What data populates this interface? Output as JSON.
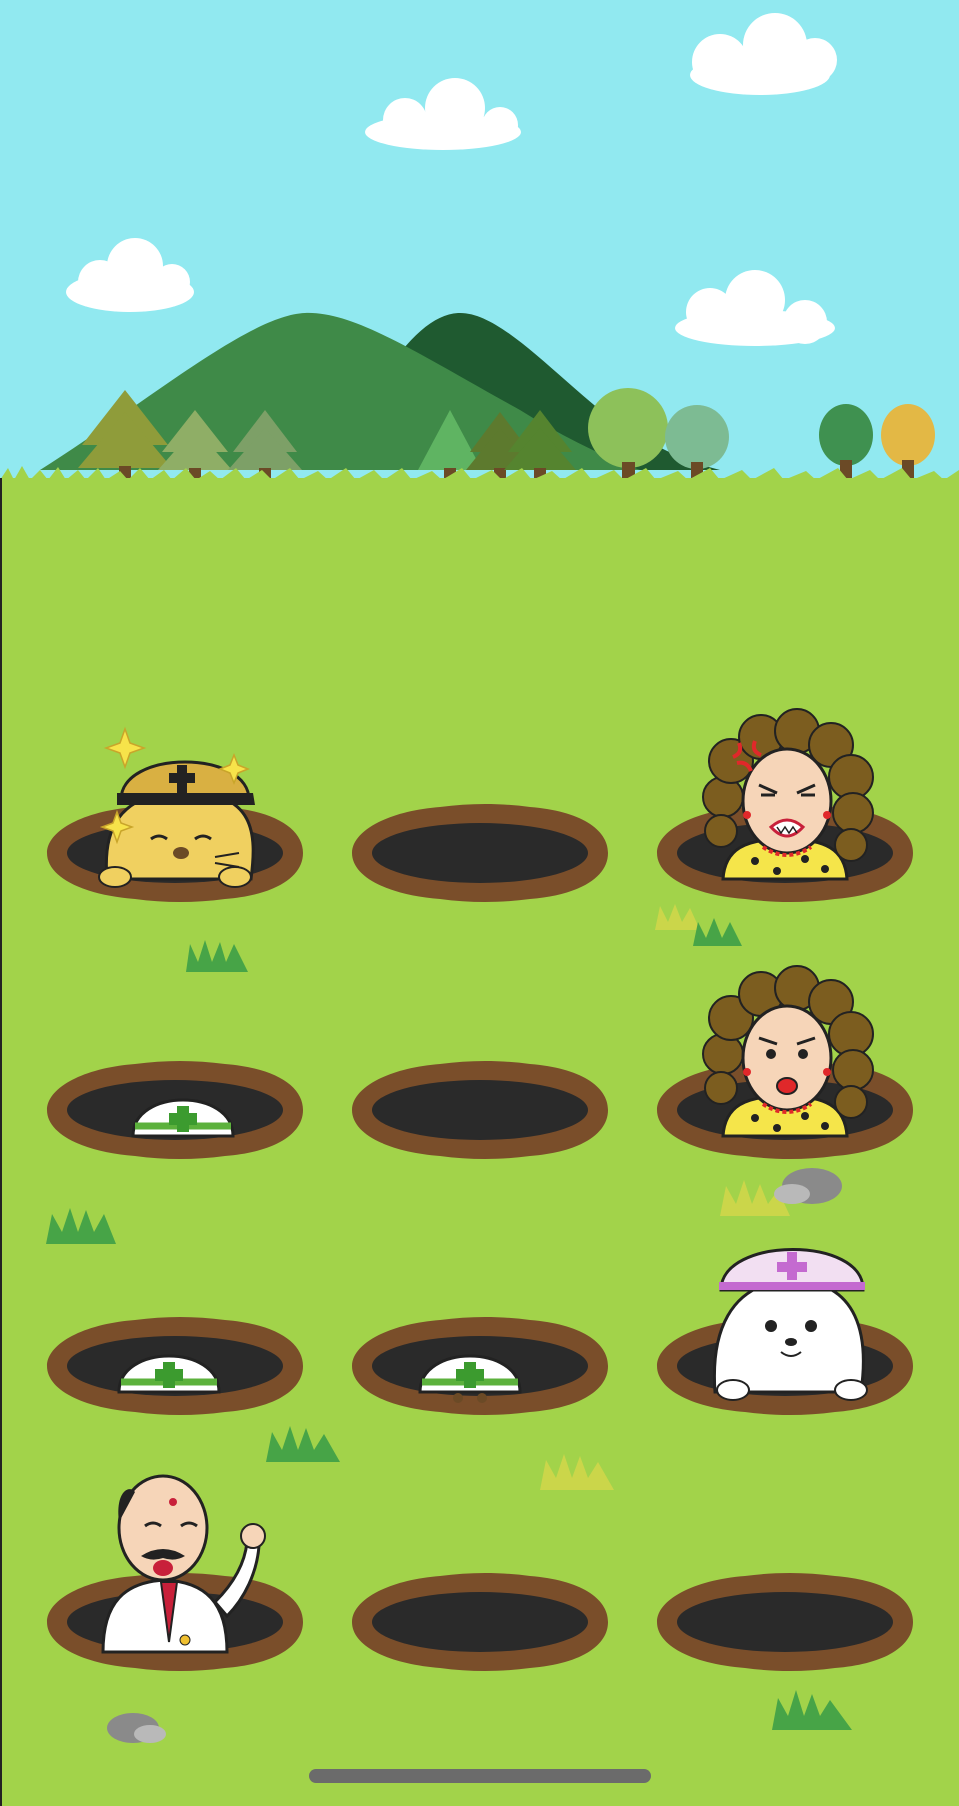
{
  "game": {
    "grid": {
      "rows": 4,
      "cols": 3
    },
    "holes": [
      {
        "row": 0,
        "col": 0,
        "occupant": "golden-mole",
        "helmet": "gold",
        "sparkle": true
      },
      {
        "row": 0,
        "col": 1,
        "occupant": "none"
      },
      {
        "row": 0,
        "col": 2,
        "occupant": "angry-lady"
      },
      {
        "row": 1,
        "col": 0,
        "occupant": "white-helmet-peek"
      },
      {
        "row": 1,
        "col": 1,
        "occupant": "none"
      },
      {
        "row": 1,
        "col": 2,
        "occupant": "lady"
      },
      {
        "row": 2,
        "col": 0,
        "occupant": "white-helmet-peek"
      },
      {
        "row": 2,
        "col": 1,
        "occupant": "white-helmet-peek"
      },
      {
        "row": 2,
        "col": 2,
        "occupant": "pink-helmet-seal"
      },
      {
        "row": 3,
        "col": 0,
        "occupant": "bald-doctor"
      },
      {
        "row": 3,
        "col": 1,
        "occupant": "none"
      },
      {
        "row": 3,
        "col": 2,
        "occupant": "none"
      }
    ]
  },
  "colors": {
    "sky": "#91e9f0",
    "grass": "#a2d34a",
    "hole_rim": "#7a4e2a",
    "hole_inside": "#2a2a2a",
    "mountain_light": "#3f8a48",
    "mountain_dark": "#1f5a30"
  },
  "icons": [
    "cloud-icon",
    "mountain-icon",
    "tree-icon",
    "grass-tuft-icon",
    "rock-icon",
    "sparkle-icon"
  ]
}
